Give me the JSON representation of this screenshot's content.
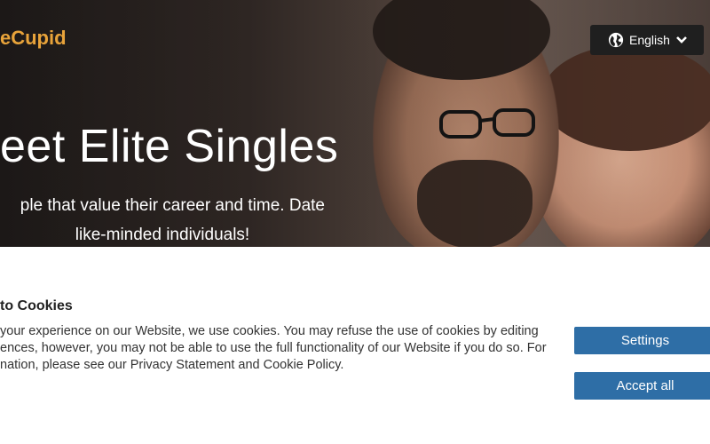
{
  "header": {
    "logo_text": "eCupid",
    "language_label": "English"
  },
  "hero": {
    "title": "eet Elite Singles",
    "subtitle_line1": "ple that value their career and time. Date",
    "subtitle_line2": "like-minded individuals!"
  },
  "cookie_banner": {
    "title": "to Cookies",
    "text_line1": "your experience on our Website, we use cookies. You may refuse the use of cookies by editing",
    "text_line2": "ences, however, you may not be able to use the full functionality of our Website if you do so. For",
    "text_line3": "nation, please see our Privacy Statement and Cookie Policy.",
    "settings_label": "Settings",
    "accept_label": "Accept all"
  },
  "colors": {
    "brand": "#e8a33a",
    "button": "#2e6ea6",
    "lang_button_bg": "#1f1f1f"
  },
  "icons": [
    "globe-icon",
    "chevron-down-icon"
  ]
}
